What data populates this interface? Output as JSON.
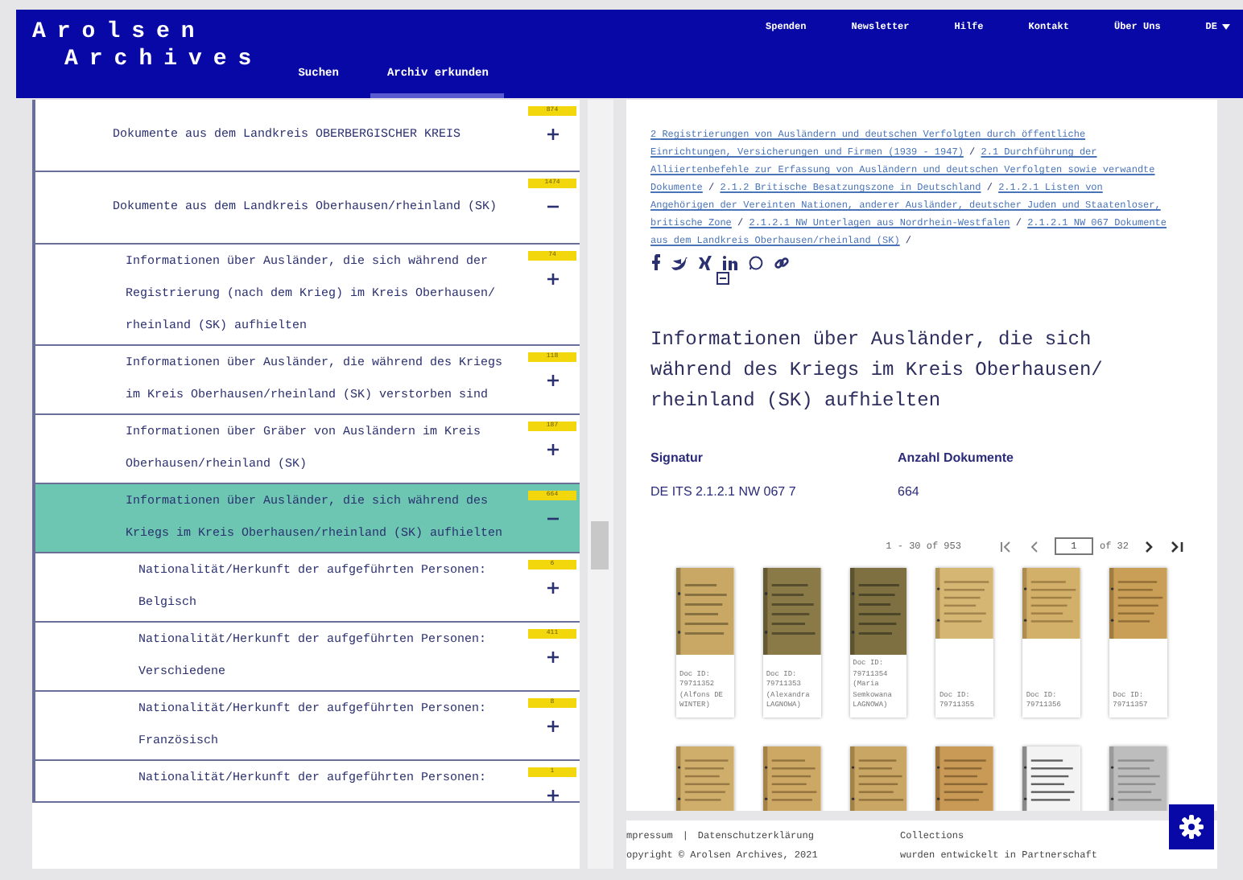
{
  "header": {
    "logo_lines": [
      "Arolsen",
      "Archives"
    ],
    "tabs": [
      {
        "label": "Suchen",
        "selected": false
      },
      {
        "label": "Archiv erkunden",
        "selected": true
      }
    ],
    "nav": [
      "Spenden",
      "Newsletter",
      "Hilfe",
      "Kontakt",
      "Über Uns"
    ],
    "language": "DE"
  },
  "tree": [
    {
      "label": "Dokumente aus dem Landkreis OBERBERGISCHER KREIS",
      "count": "874",
      "expanded": false,
      "selected": false
    },
    {
      "label": "Dokumente aus dem Landkreis Oberhausen/rheinland (SK)",
      "count": "1474",
      "expanded": true,
      "selected": false,
      "children": [
        {
          "label": "Informationen über Ausländer, die sich während der Registrierung (nach dem Krieg) im Kreis Oberhausen/ rheinland (SK) aufhielten",
          "count": "74",
          "expanded": false,
          "selected": false
        },
        {
          "label": "Informationen über Ausländer, die während des Kriegs im Kreis Oberhausen/rheinland (SK) verstorben sind",
          "count": "118",
          "expanded": false,
          "selected": false
        },
        {
          "label": "Informationen über Gräber von Ausländern im Kreis Oberhausen/rheinland (SK)",
          "count": "187",
          "expanded": false,
          "selected": false
        },
        {
          "label": "Informationen über Ausländer, die sich während des Kriegs im Kreis Oberhausen/rheinland (SK) aufhielten",
          "count": "664",
          "expanded": true,
          "selected": true,
          "children": [
            {
              "label": "Nationalität/Herkunft der aufgeführten Personen: Belgisch",
              "count": "6",
              "expanded": false,
              "selected": false
            },
            {
              "label": "Nationalität/Herkunft der aufgeführten Personen: Verschiedene",
              "count": "411",
              "expanded": false,
              "selected": false
            },
            {
              "label": "Nationalität/Herkunft der aufgeführten Personen: Französisch",
              "count": "8",
              "expanded": false,
              "selected": false
            },
            {
              "label": "Nationalität/Herkunft der aufgeführten Personen:",
              "count": "1",
              "expanded": false,
              "selected": false
            }
          ]
        }
      ]
    }
  ],
  "breadcrumb_separator": "/",
  "breadcrumb": [
    "2 Registrierungen von Ausländern und deutschen Verfolgten durch öffentliche Einrichtungen, Versicherungen und Firmen (1939 - 1947)",
    "2.1 Durchführung der Alliiertenbefehle zur Erfassung von Ausländern und deutschen Verfolgten sowie verwandte Dokumente",
    "2.1.2 Britische Besatzungszone in Deutschland",
    "2.1.2.1 Listen von Angehörigen der Vereinten Nationen, anderer Ausländer, deutscher Juden und Staatenloser, britische Zone",
    "2.1.2.1 NW Unterlagen aus Nordrhein-Westfalen",
    "2.1.2.1 NW 067 Dokumente aus dem Landkreis Oberhausen/rheinland (SK)"
  ],
  "title": "Informationen über Ausländer, die sich während des Kriegs im Kreis Oberhausen/ rheinland (SK) aufhielten",
  "fields": [
    {
      "label": "Signatur",
      "value": "DE ITS 2.1.2.1 NW 067 7"
    },
    {
      "label": "Anzahl Dokumente",
      "value": "664"
    }
  ],
  "pagination": {
    "range": "1 - 30 of 953",
    "page": "1",
    "of": "of 32"
  },
  "documents": [
    {
      "kind": "picture",
      "caption": "Doc ID: 79711352 (Alfons DE WINTER)"
    },
    {
      "kind": "picture",
      "caption": "Doc ID: 79711353 (Alexandra LAGNOWA)"
    },
    {
      "kind": "picture",
      "caption": "Doc ID: 79711354 (Maria Semkowana LAGNOWA)"
    },
    {
      "kind": "picture",
      "caption": "Doc ID: 79711355"
    },
    {
      "kind": "picture",
      "caption": "Doc ID: 79711356"
    },
    {
      "kind": "picture",
      "caption": "Doc ID: 79711357"
    },
    {
      "kind": "picture"
    },
    {
      "kind": "picture"
    },
    {
      "kind": "picture"
    },
    {
      "kind": "picture"
    },
    {
      "kind": "picture"
    },
    {
      "kind": "picture"
    }
  ],
  "footer": {
    "links": [
      "mpressum",
      "Datenschutzerklärung"
    ],
    "separator": "|",
    "copyright": "opyright © Arolsen Archives, 2021",
    "partner_lines": [
      "Collections",
      "wurden entwickelt in Partnerschaft"
    ]
  }
}
